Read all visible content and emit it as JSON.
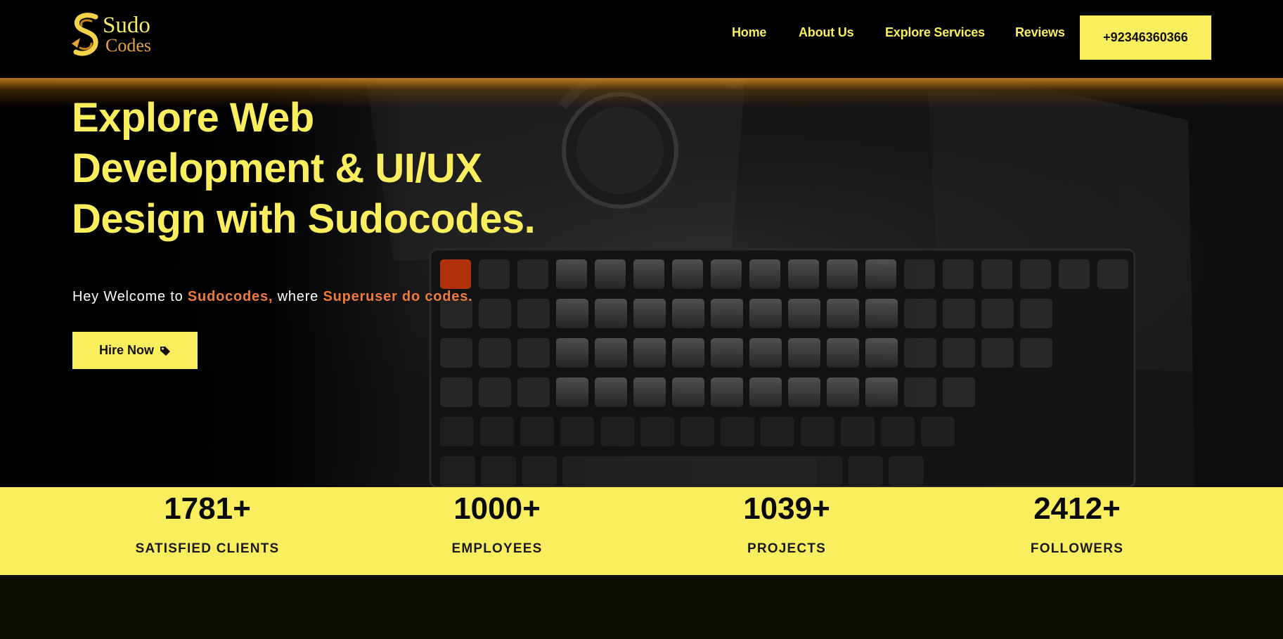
{
  "brand": {
    "logo_line1": "Sudo",
    "logo_line2": "Codes",
    "accent": "#f9ee5e",
    "highlight": "#ef7a3a"
  },
  "nav": {
    "items": [
      {
        "label": "Home"
      },
      {
        "label": "About Us"
      },
      {
        "label": "Explore Services"
      },
      {
        "label": "Reviews"
      }
    ],
    "phone": "+92346360366"
  },
  "hero": {
    "title_lines": [
      "Explore Web",
      "Development & UI/UX",
      "Design with Sudocodes."
    ],
    "subtitle_prefix": "Hey Welcome to ",
    "subtitle_brand": "Sudocodes,",
    "subtitle_mid": " where ",
    "subtitle_tagline": "Superuser do codes.",
    "cta_label": "Hire Now",
    "cta_icon": "tag-icon"
  },
  "stats": [
    {
      "value": "1781+",
      "label": "SATISFIED CLIENTS"
    },
    {
      "value": "1000+",
      "label": "EMPLOYEES"
    },
    {
      "value": "1039+",
      "label": "PROJECTS"
    },
    {
      "value": "2412+",
      "label": "FOLLOWERS"
    }
  ]
}
